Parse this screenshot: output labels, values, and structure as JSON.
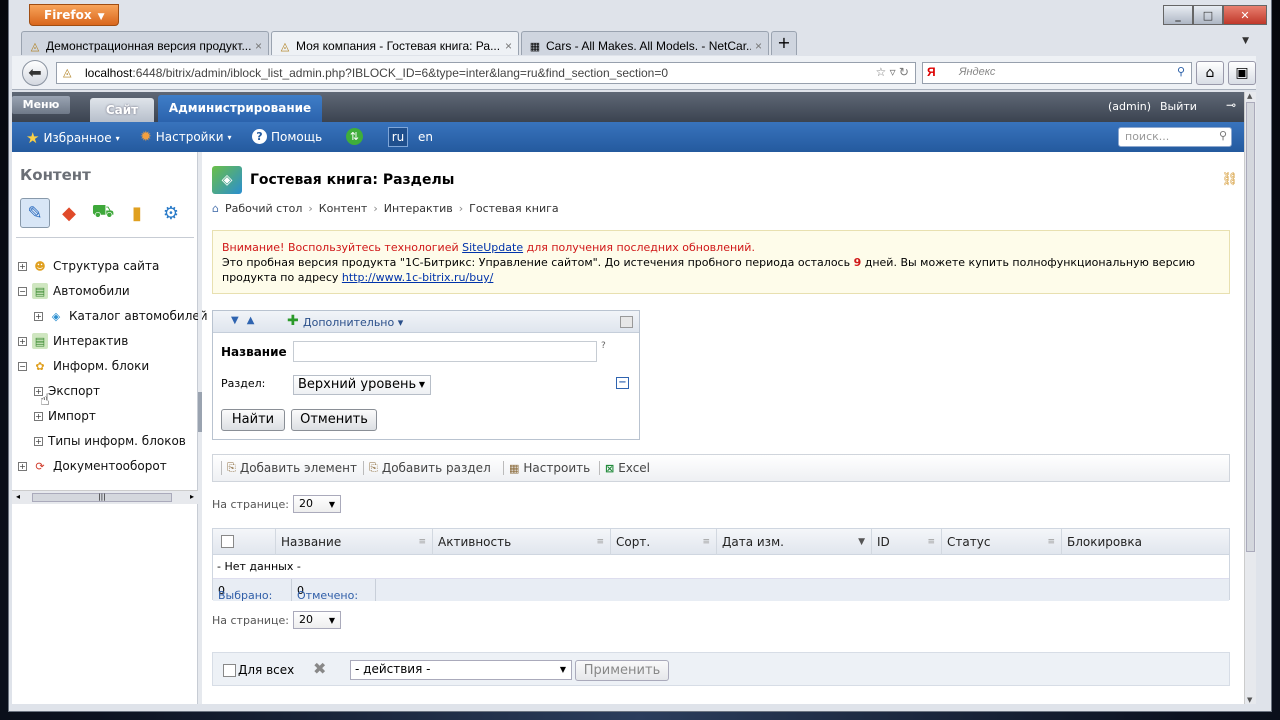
{
  "browser": {
    "menu_label": "Firefox",
    "tabs": [
      {
        "title": "Демонстрационная версия продукт...",
        "close": "×"
      },
      {
        "title": "Моя компания - Гостевая книга: Ра...",
        "close": "×"
      },
      {
        "title": "Cars - All Makes. All Models. - NetCar...",
        "close": "×"
      }
    ],
    "new_tab": "+",
    "url_host": "localhost",
    "url_rest": ":6448/bitrix/admin/iblock_list_admin.php?IBLOCK_ID=6&type=inter&lang=ru&find_section_section=0",
    "search_engine": "Я",
    "search_placeholder": "Яндекс"
  },
  "admin": {
    "menu_button": "Меню",
    "tab_site": "Сайт",
    "tab_admin": "Администрирование",
    "user": "(admin)",
    "logout": "Выйти",
    "favorites": "Избранное",
    "settings": "Настройки",
    "help": "Помощь",
    "lang_ru": "ru",
    "lang_en": "en",
    "search_placeholder": "поиск..."
  },
  "sidebar": {
    "title": "Контент",
    "tree": [
      {
        "label": "Структура сайта",
        "toggle": "+"
      },
      {
        "label": "Автомобили",
        "toggle": "−"
      },
      {
        "label": "Каталог автомобилей",
        "toggle": "+"
      },
      {
        "label": "Интерактив",
        "toggle": "+"
      },
      {
        "label": "Информ. блоки",
        "toggle": "−"
      },
      {
        "label": "Экспорт",
        "toggle": "+"
      },
      {
        "label": "Импорт",
        "toggle": "+"
      },
      {
        "label": "Типы информ. блоков",
        "toggle": "+"
      },
      {
        "label": "Документооборот",
        "toggle": "+"
      }
    ]
  },
  "page": {
    "title": "Гостевая книга: Разделы",
    "breadcrumbs": [
      "Рабочий стол",
      "Контент",
      "Интерактив",
      "Гостевая книга"
    ],
    "notice": {
      "warn_prefix": "Внимание! Воспользуйтесь технологией ",
      "warn_link": "SiteUpdate",
      "warn_suffix": " для получения последних обновлений.",
      "line2_a": "Это пробная версия продукта \"1С-Битрикс: Управление сайтом\". До истечения пробного периода осталось ",
      "days": "9",
      "line2_b": " дней. Вы можете купить полнофункциональную версию",
      "line3": "продукта по адресу ",
      "buy_link": "http://www.1c-bitrix.ru/buy/"
    },
    "filter": {
      "more": "Дополнительно",
      "name_label": "Название",
      "name_value": "",
      "hint": "?",
      "section_label": "Раздел:",
      "section_value": "Верхний уровень",
      "find": "Найти",
      "cancel": "Отменить"
    },
    "toolbar": {
      "add_element": "Добавить элемент",
      "add_section": "Добавить раздел",
      "configure": "Настроить",
      "excel": "Excel"
    },
    "per_page_label": "На странице:",
    "per_page_value": "20",
    "grid": {
      "columns": [
        "Название",
        "Активность",
        "Сорт.",
        "Дата изм.",
        "ID",
        "Статус",
        "Блокировка"
      ],
      "no_data": "- Нет данных -",
      "selected_label": "Выбрано:",
      "selected_value": "0",
      "checked_label": "Отмечено:",
      "checked_value": "0"
    },
    "actions": {
      "for_all": "Для всех",
      "select": "- действия -",
      "apply": "Применить"
    }
  }
}
